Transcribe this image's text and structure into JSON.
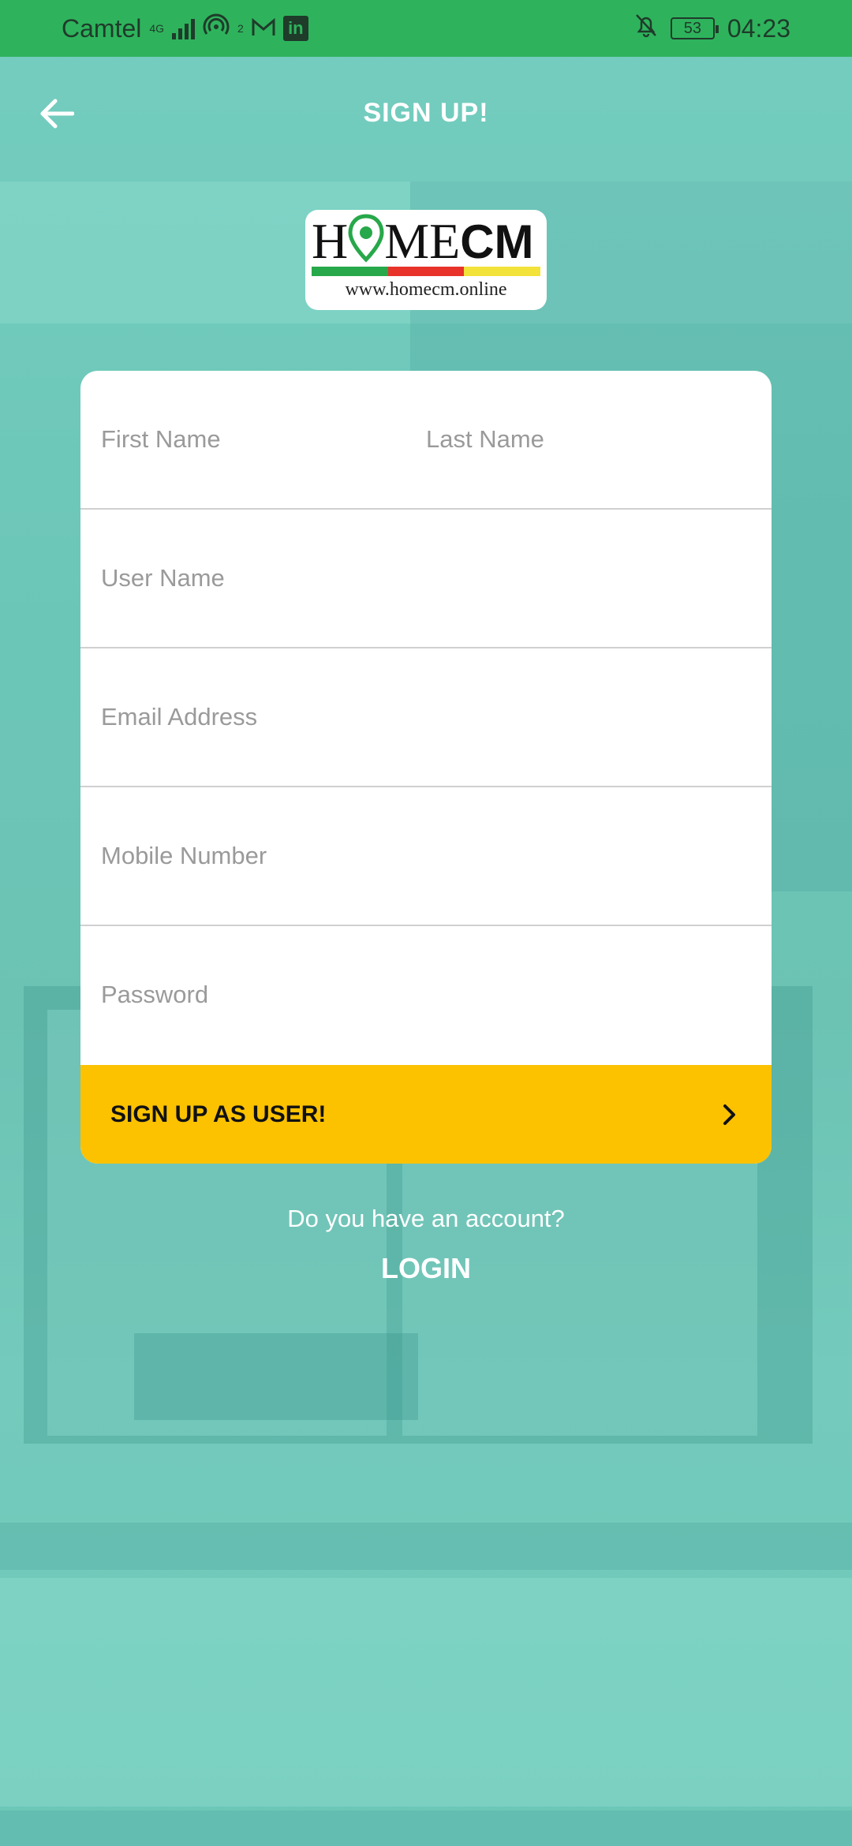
{
  "status_bar": {
    "carrier": "Camtel",
    "network_type": "4G",
    "hotspot_count": "2",
    "battery": "53",
    "time": "04:23",
    "icons": [
      "signal-icon",
      "hotspot-icon",
      "gmail-icon",
      "linkedin-icon",
      "notifications-off-icon",
      "battery-icon"
    ]
  },
  "header": {
    "title": "SIGN UP!"
  },
  "logo": {
    "url_text": "www.homecm.online",
    "wordmark_left": "H",
    "wordmark_mid": "ME",
    "wordmark_bold": "CM",
    "stripe_colors": [
      "#27a84a",
      "#e8332b",
      "#f2e23a"
    ]
  },
  "form": {
    "first_name_placeholder": "First Name",
    "last_name_placeholder": "Last Name",
    "username_placeholder": "User Name",
    "email_placeholder": "Email Address",
    "mobile_placeholder": "Mobile Number",
    "password_placeholder": "Password",
    "submit_label": "SIGN UP AS USER!"
  },
  "footer": {
    "question": "Do you have an account?",
    "login_label": "LOGIN"
  },
  "colors": {
    "status_bar": "#2eb35c",
    "background": "#70c9bb",
    "accent_button": "#fcc200"
  }
}
